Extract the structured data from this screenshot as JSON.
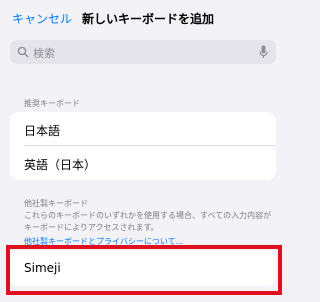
{
  "nav": {
    "cancel_label": "キャンセル",
    "title": "新しいキーボードを追加"
  },
  "search": {
    "placeholder": "検索",
    "icon": "search-icon",
    "mic_icon": "microphone-icon"
  },
  "suggested": {
    "header": "推奨キーボード",
    "items": [
      {
        "label": "日本語"
      },
      {
        "label": "英語（日本）"
      }
    ]
  },
  "third_party": {
    "header": "他社製キーボード",
    "description": "これらのキーボードのいずれかを使用する場合、すべての入力内容がキーボードによりアクセスされます。",
    "link_label": "他社製キーボードとプライバシーについて...",
    "items": [
      {
        "label": "Simeji"
      }
    ]
  },
  "colors": {
    "accent": "#007aff",
    "background": "#f2f2f7",
    "highlight": "#e01020"
  }
}
